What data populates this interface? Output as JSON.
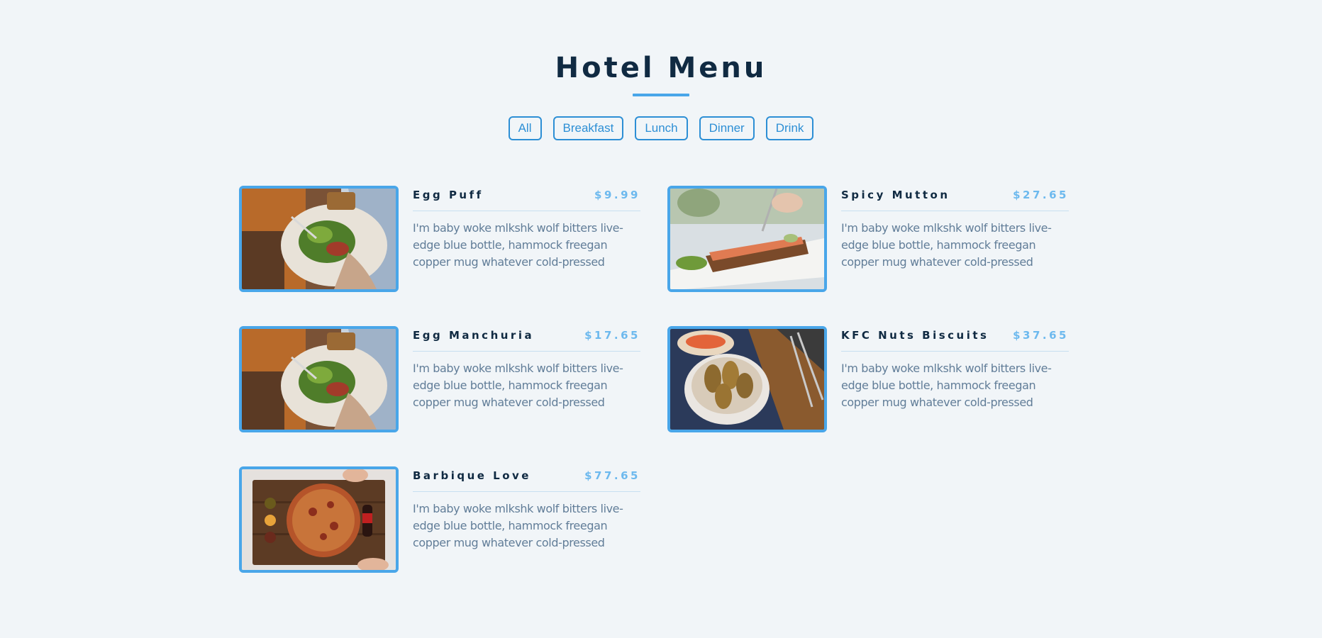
{
  "header": {
    "title": "Hotel Menu"
  },
  "filters": [
    {
      "label": "All"
    },
    {
      "label": "Breakfast"
    },
    {
      "label": "Lunch"
    },
    {
      "label": "Dinner"
    },
    {
      "label": "Drink"
    }
  ],
  "menu": {
    "items": [
      {
        "name": "Egg Puff",
        "price": "$9.99",
        "desc": "I'm baby woke mlkshk wolf bitters live-edge blue bottle, hammock freegan copper mug whatever cold-pressed",
        "image": "salad-plate-image"
      },
      {
        "name": "Spicy Mutton",
        "price": "$27.65",
        "desc": "I'm baby woke mlkshk wolf bitters live-edge blue bottle, hammock freegan copper mug whatever cold-pressed",
        "image": "toast-plate-image"
      },
      {
        "name": "Egg Manchuria",
        "price": "$17.65",
        "desc": "I'm baby woke mlkshk wolf bitters live-edge blue bottle, hammock freegan copper mug whatever cold-pressed",
        "image": "salad-plate-image"
      },
      {
        "name": "KFC Nuts Biscuits",
        "price": "$37.65",
        "desc": "I'm baby woke mlkshk wolf bitters live-edge blue bottle, hammock freegan copper mug whatever cold-pressed",
        "image": "croquettes-bowl-image"
      },
      {
        "name": "Barbique Love",
        "price": "$77.65",
        "desc": "I'm baby woke mlkshk wolf bitters live-edge blue bottle, hammock freegan copper mug whatever cold-pressed",
        "image": "pizza-board-image"
      }
    ]
  },
  "colors": {
    "background": "#f1f5f8",
    "accent": "#49a6e9",
    "heading": "#102a42",
    "price": "#6db9ee",
    "text": "#617d98"
  }
}
